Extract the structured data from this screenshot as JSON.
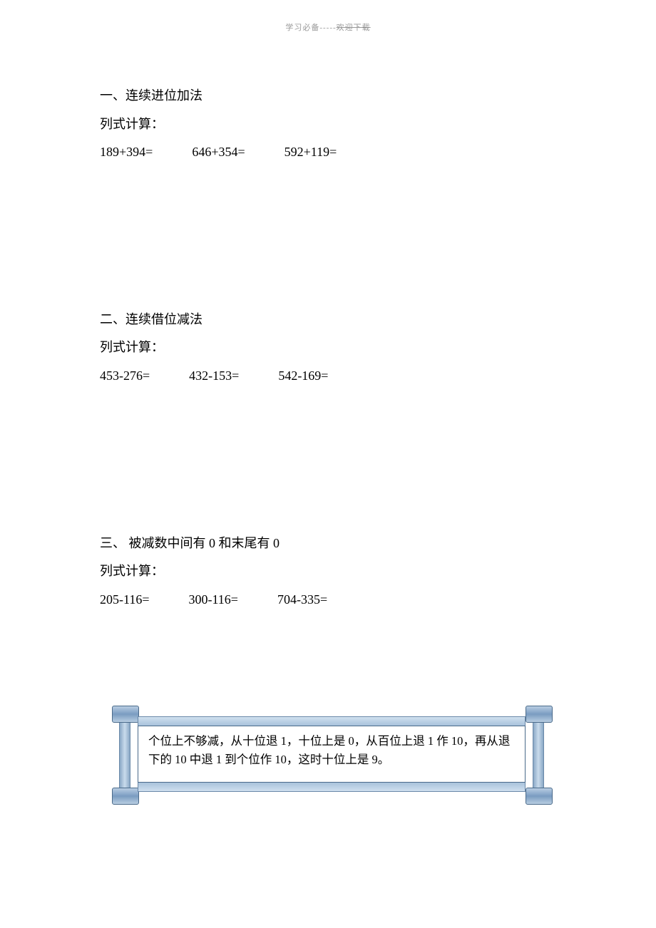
{
  "header": {
    "left": "学习必备",
    "sep": "-----",
    "right": "欢迎下载"
  },
  "sections": [
    {
      "title": "一、连续进位加法",
      "sub": "列式计算：",
      "problems": [
        "189+394=",
        "646+354=",
        "592+119="
      ]
    },
    {
      "title": "二、连续借位减法",
      "sub": "列式计算：",
      "problems": [
        "453-276=",
        "432-153=",
        "542-169="
      ]
    },
    {
      "title": "三、 被减数中间有 0 和末尾有 0",
      "sub": "列式计算：",
      "problems": [
        "205-116=",
        "300-116=",
        "704-335="
      ]
    }
  ],
  "note": "个位上不够减，从十位退 1，十位上是 0，从百位上退 1 作 10，再从退下的 10 中退 1 到个位作 10，这时十位上是 9。"
}
